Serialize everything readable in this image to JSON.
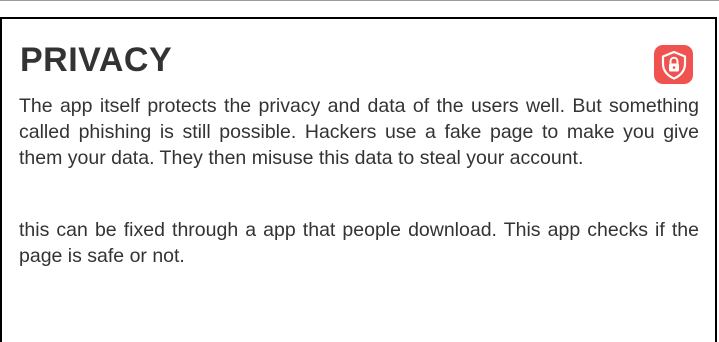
{
  "card": {
    "title": "PRIVACY",
    "icon": "shield-lock-icon",
    "paragraphs": [
      "The app itself protects the privacy and data of the users well. But something called phishing is still possible. Hackers use a fake page to make you give them your data. They then misuse this data to steal your account.",
      "this can be fixed through a app that people download. This app checks if the page is safe or not."
    ]
  },
  "colors": {
    "icon_background": "#f0524f",
    "text": "#333333",
    "border": "#000000"
  }
}
